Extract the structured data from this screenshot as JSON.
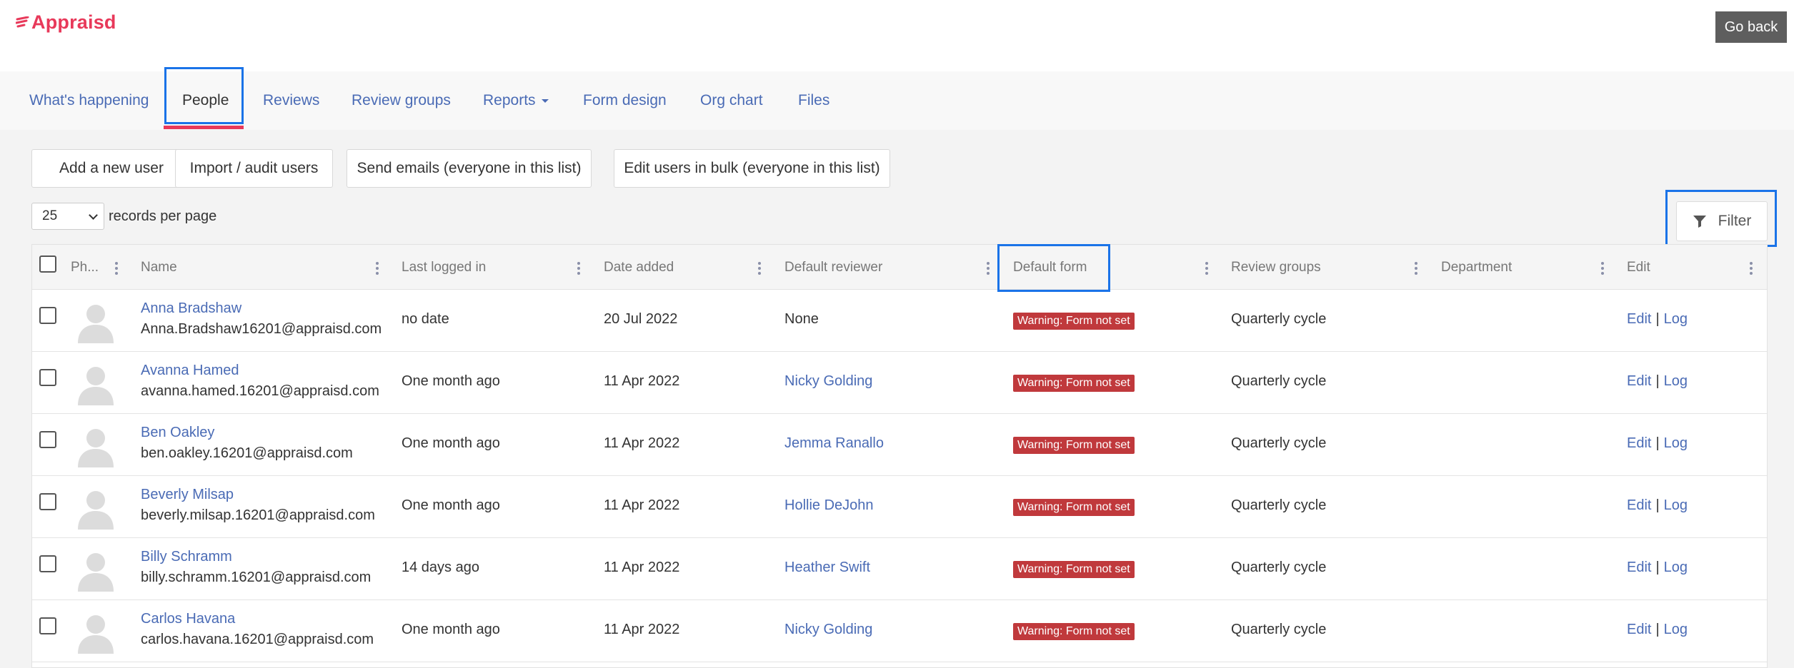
{
  "app": {
    "logo_text": "Appraisd",
    "go_back_label": "Go back"
  },
  "nav": {
    "items": [
      {
        "label": "What's happening"
      },
      {
        "label": "People"
      },
      {
        "label": "Reviews"
      },
      {
        "label": "Review groups"
      },
      {
        "label": "Reports"
      },
      {
        "label": "Form design"
      },
      {
        "label": "Org chart"
      },
      {
        "label": "Files"
      }
    ],
    "active": "People"
  },
  "actions": {
    "add_user": "Add a new user",
    "import_audit": "Import / audit users",
    "send_emails": "Send emails (everyone in this list)",
    "edit_bulk": "Edit users in bulk (everyone in this list)"
  },
  "pagination": {
    "per_page_value": "25",
    "per_page_label": "records per page"
  },
  "filter": {
    "label": "Filter"
  },
  "table": {
    "columns": {
      "photo": "Ph...",
      "name": "Name",
      "last_logged_in": "Last logged in",
      "date_added": "Date added",
      "default_reviewer": "Default reviewer",
      "default_form": "Default form",
      "review_groups": "Review groups",
      "department": "Department",
      "edit": "Edit"
    },
    "rows": [
      {
        "name": "Anna Bradshaw",
        "email": "Anna.Bradshaw16201@appraisd.com",
        "last_logged_in": "no date",
        "date_added": "20 Jul 2022",
        "reviewer": "None",
        "reviewer_is_link": false,
        "form": "Warning: Form not set",
        "review_groups": "Quarterly cycle",
        "department": "",
        "edit": "Edit",
        "log": "Log"
      },
      {
        "name": "Avanna Hamed",
        "email": "avanna.hamed.16201@appraisd.com",
        "last_logged_in": "One month ago",
        "date_added": "11 Apr 2022",
        "reviewer": "Nicky Golding",
        "reviewer_is_link": true,
        "form": "Warning: Form not set",
        "review_groups": "Quarterly cycle",
        "department": "",
        "edit": "Edit",
        "log": "Log"
      },
      {
        "name": "Ben Oakley",
        "email": "ben.oakley.16201@appraisd.com",
        "last_logged_in": "One month ago",
        "date_added": "11 Apr 2022",
        "reviewer": "Jemma Ranallo",
        "reviewer_is_link": true,
        "form": "Warning: Form not set",
        "review_groups": "Quarterly cycle",
        "department": "",
        "edit": "Edit",
        "log": "Log"
      },
      {
        "name": "Beverly Milsap",
        "email": "beverly.milsap.16201@appraisd.com",
        "last_logged_in": "One month ago",
        "date_added": "11 Apr 2022",
        "reviewer": "Hollie DeJohn",
        "reviewer_is_link": true,
        "form": "Warning: Form not set",
        "review_groups": "Quarterly cycle",
        "department": "",
        "edit": "Edit",
        "log": "Log"
      },
      {
        "name": "Billy Schramm",
        "email": "billy.schramm.16201@appraisd.com",
        "last_logged_in": "14 days ago",
        "date_added": "11 Apr 2022",
        "reviewer": "Heather Swift",
        "reviewer_is_link": true,
        "form": "Warning: Form not set",
        "review_groups": "Quarterly cycle",
        "department": "",
        "edit": "Edit",
        "log": "Log"
      },
      {
        "name": "Carlos Havana",
        "email": "carlos.havana.16201@appraisd.com",
        "last_logged_in": "One month ago",
        "date_added": "11 Apr 2022",
        "reviewer": "Nicky Golding",
        "reviewer_is_link": true,
        "form": "Warning: Form not set",
        "review_groups": "Quarterly cycle",
        "department": "",
        "edit": "Edit",
        "log": "Log"
      }
    ]
  },
  "colors": {
    "brand": "#e8395a",
    "link": "#4a6bb5",
    "warning_badge": "#c0393c",
    "highlight": "#1a73e8"
  },
  "icons": {
    "logo": "appraisd-logo-icon",
    "filter": "filter-icon",
    "avatar": "avatar-placeholder-icon",
    "column_menu": "kebab-menu-icon",
    "dropdown": "chevron-down-icon"
  }
}
